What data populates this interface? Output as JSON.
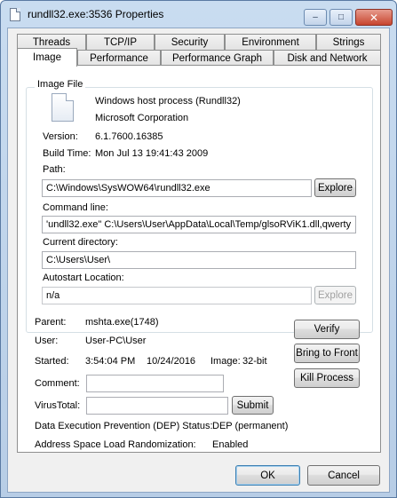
{
  "window": {
    "title": "rundll32.exe:3536 Properties"
  },
  "caption_buttons": {
    "minimize": "–",
    "maximize": "□",
    "close": "✕"
  },
  "tabs_row1": [
    "Threads",
    "TCP/IP",
    "Security",
    "Environment",
    "Strings"
  ],
  "tabs_row2": [
    "Image",
    "Performance",
    "Performance Graph",
    "Disk and Network"
  ],
  "image_file": {
    "legend": "Image File",
    "description": "Windows host process (Rundll32)",
    "company": "Microsoft Corporation",
    "version_label": "Version:",
    "version": "6.1.7600.16385",
    "build_label": "Build Time:",
    "build_time": "Mon Jul 13 19:41:43 2009",
    "path_label": "Path:",
    "path": "C:\\Windows\\SysWOW64\\rundll32.exe",
    "explore_label": "Explore",
    "cmdline_label": "Command line:",
    "cmdline": "'undll32.exe\" C:\\Users\\User\\AppData\\Local\\Temp/glsoRViK1.dll,qwerty",
    "curdir_label": "Current directory:",
    "curdir": "C:\\Users\\User\\",
    "autostart_label": "Autostart Location:",
    "autostart": "n/a",
    "explore2_label": "Explore"
  },
  "process": {
    "parent_label": "Parent:",
    "parent": "mshta.exe(1748)",
    "user_label": "User:",
    "user": "User-PC\\User",
    "started_label": "Started:",
    "started_time": "3:54:04 PM",
    "started_date": "10/24/2016",
    "image_bits_label": "Image:",
    "image_bits": "32-bit",
    "comment_label": "Comment:",
    "comment": "",
    "virustotal_label": "VirusTotal:",
    "virustotal": "",
    "submit_label": "Submit",
    "dep_label": "Data Execution Prevention (DEP) Status:",
    "dep": "DEP (permanent)",
    "aslr_label": "Address Space Load Randomization:",
    "aslr": "Enabled"
  },
  "actions": {
    "verify": "Verify",
    "bring_to_front": "Bring to Front",
    "kill_process": "Kill Process"
  },
  "footer": {
    "ok": "OK",
    "cancel": "Cancel"
  }
}
